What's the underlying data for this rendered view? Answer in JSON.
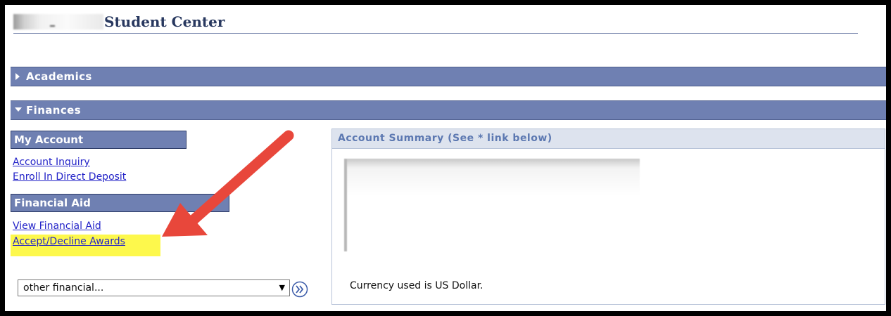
{
  "header": {
    "title": "Student Center"
  },
  "sections": {
    "academics": {
      "label": "Academics"
    },
    "finances": {
      "label": "Finances"
    }
  },
  "my_account": {
    "heading": "My Account",
    "links": [
      "Account Inquiry",
      "Enroll In Direct Deposit"
    ]
  },
  "financial_aid": {
    "heading": "Financial Aid",
    "links": [
      "View Financial Aid",
      "Accept/Decline Awards"
    ]
  },
  "other_financial": {
    "selected": "other financial..."
  },
  "account_summary": {
    "heading": "Account Summary (See * link below)",
    "currency_note": "Currency used is US Dollar."
  },
  "colors": {
    "section_bar": "#6f80b2",
    "link": "#2323c8",
    "highlight": "#fdf84c",
    "annotation_arrow": "#e8473b"
  }
}
